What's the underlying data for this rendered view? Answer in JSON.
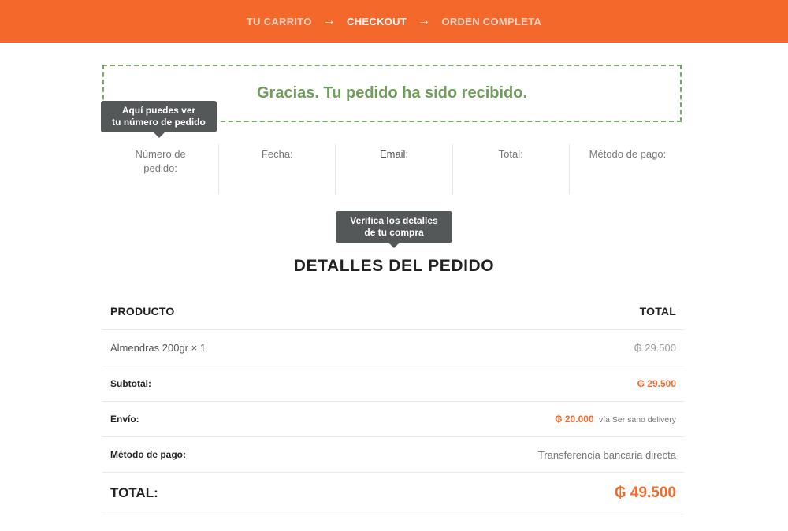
{
  "breadcrumb": {
    "steps": [
      "TU CARRITO",
      "CHECKOUT",
      "ORDEN COMPLETA"
    ],
    "active_step": "CHECKOUT",
    "separator_icon": "arrow-right-icon"
  },
  "notice": {
    "thanks_text": "Gracias. Tu pedido ha sido recibido."
  },
  "tooltips": {
    "order_number_tip_line1": "Aquí puedes ver",
    "order_number_tip_line2": "tu número de pedido",
    "details_tip_line1": "Verifica los detalles",
    "details_tip_line2": "de tu compra"
  },
  "overview": {
    "order_number_label": "Número de pedido:",
    "date_label": "Fecha:",
    "email_label": "Email:",
    "total_label": "Total:",
    "payment_method_label": "Método de pago:"
  },
  "order_details": {
    "title": "DETALLES DEL PEDIDO",
    "col_product": "PRODUCTO",
    "col_total": "TOTAL",
    "items": [
      {
        "name": "Almendras 200gr",
        "qty": "× 1",
        "price": "₲ 29.500"
      }
    ],
    "subtotal_label": "Subtotal:",
    "subtotal_value": "₲ 29.500",
    "shipping_label": "Envío:",
    "shipping_value": "₲ 20.000",
    "shipping_note": "vía Ser sano delivery",
    "payment_label": "Método de pago:",
    "payment_value": "Transferencia bancaria directa",
    "total_label": "TOTAL:",
    "total_value": "₲ 49.500"
  },
  "colors": {
    "brand_orange": "#f4682c",
    "accent_orange": "#ef6a2f",
    "success_green": "#6f9d5a",
    "tooltip_bg": "#555858"
  }
}
